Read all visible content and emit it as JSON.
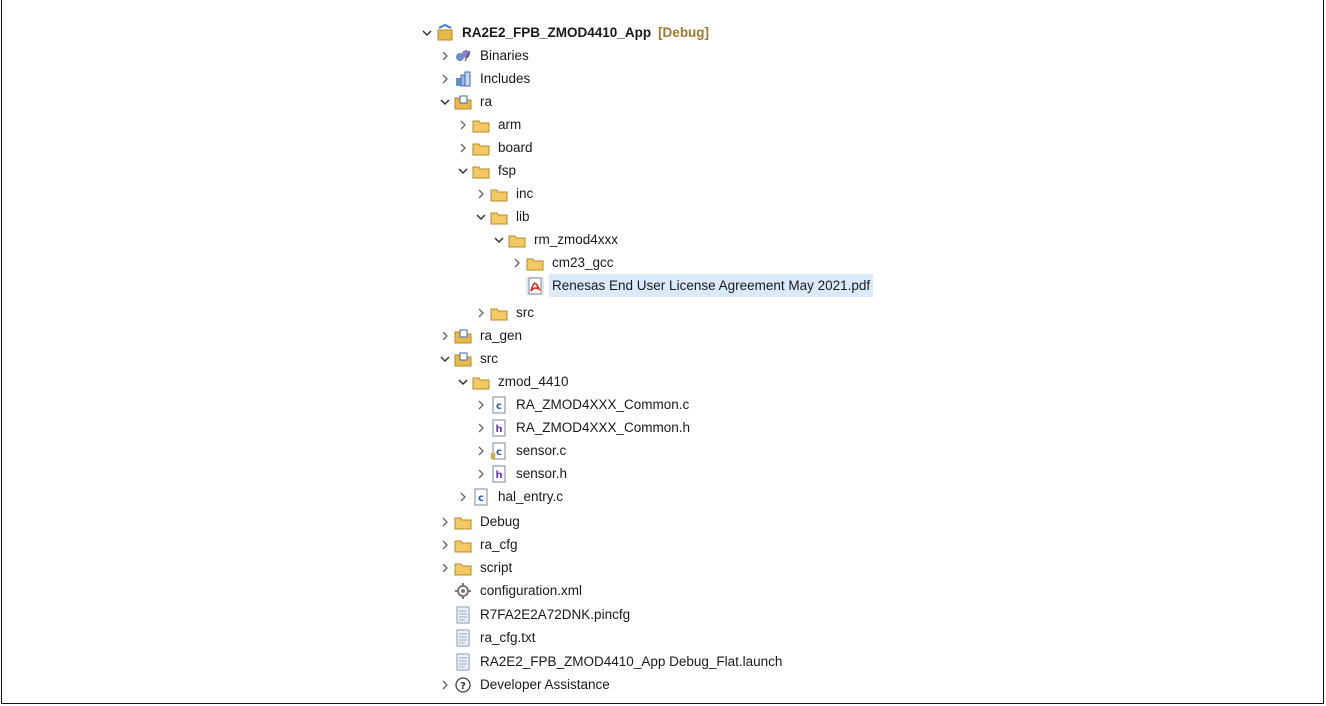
{
  "project_explorer": {
    "root": {
      "label": "RA2E2_FPB_ZMOD4410_App",
      "decoration": "[Debug]"
    },
    "items": [
      {
        "label": "Binaries",
        "icon": "binaries-icon"
      },
      {
        "label": "Includes",
        "icon": "includes-icon"
      },
      {
        "label": "ra",
        "icon": "source-folder-icon"
      },
      {
        "label": "arm",
        "icon": "folder-icon"
      },
      {
        "label": "board",
        "icon": "folder-icon"
      },
      {
        "label": "fsp",
        "icon": "folder-icon"
      },
      {
        "label": "inc",
        "icon": "folder-icon"
      },
      {
        "label": "lib",
        "icon": "folder-icon"
      },
      {
        "label": "rm_zmod4xxx",
        "icon": "folder-icon"
      },
      {
        "label": "cm23_gcc",
        "icon": "folder-icon"
      },
      {
        "label": "Renesas End User License Agreement May 2021.pdf",
        "icon": "pdf-file-icon"
      },
      {
        "label": "src",
        "icon": "folder-icon"
      },
      {
        "label": "ra_gen",
        "icon": "source-folder-icon"
      },
      {
        "label": "src",
        "icon": "source-folder-icon"
      },
      {
        "label": "zmod_4410",
        "icon": "folder-icon"
      },
      {
        "label": "RA_ZMOD4XXX_Common.c",
        "icon": "c-file-icon"
      },
      {
        "label": "RA_ZMOD4XXX_Common.h",
        "icon": "h-file-icon"
      },
      {
        "label": "sensor.c",
        "icon": "c-file-icon"
      },
      {
        "label": "sensor.h",
        "icon": "h-file-icon"
      },
      {
        "label": "hal_entry.c",
        "icon": "c-file-icon"
      },
      {
        "label": "Debug",
        "icon": "folder-icon"
      },
      {
        "label": "ra_cfg",
        "icon": "folder-icon"
      },
      {
        "label": "script",
        "icon": "folder-icon"
      },
      {
        "label": "configuration.xml",
        "icon": "gear-file-icon"
      },
      {
        "label": "R7FA2E2A72DNK.pincfg",
        "icon": "text-file-icon"
      },
      {
        "label": "ra_cfg.txt",
        "icon": "text-file-icon"
      },
      {
        "label": "RA2E2_FPB_ZMOD4410_App Debug_Flat.launch",
        "icon": "text-file-icon"
      },
      {
        "label": "Developer Assistance",
        "icon": "help-icon"
      }
    ],
    "colors": {
      "selection": "#dbeafb",
      "folder": "#e8b84a",
      "decoration": "#a0782a"
    }
  }
}
